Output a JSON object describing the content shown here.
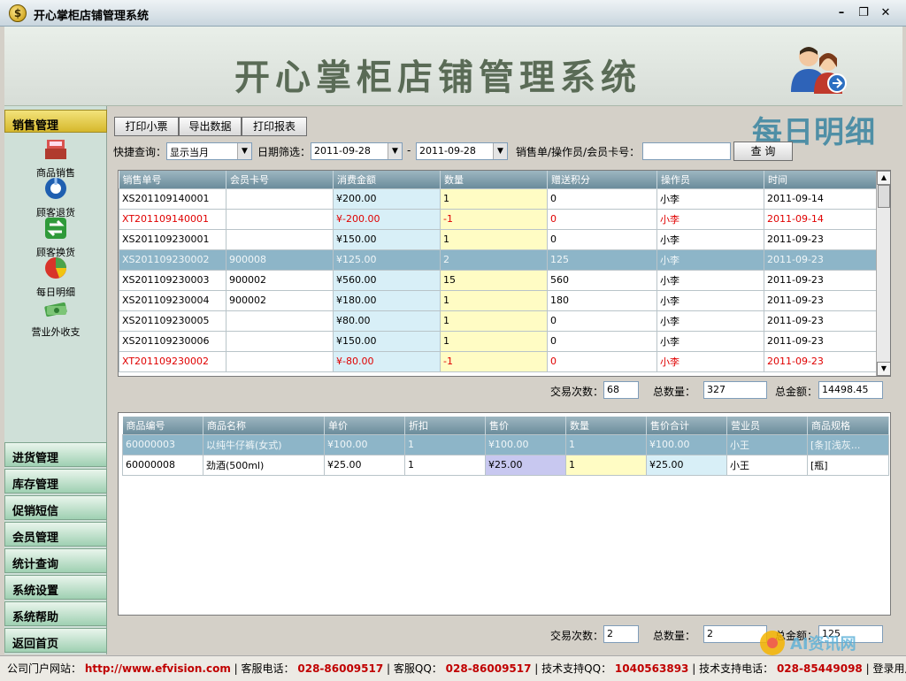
{
  "window": {
    "title": "开心掌柜店铺管理系统"
  },
  "banner": {
    "title": "开心掌柜店铺管理系统"
  },
  "sidebar": {
    "section": "销售管理",
    "icons": [
      {
        "label": "商品销售",
        "icon": "cash-register-icon",
        "color": "#c0392b"
      },
      {
        "label": "顾客退货",
        "icon": "return-icon",
        "color": "#1f5fb0"
      },
      {
        "label": "顾客换货",
        "icon": "exchange-icon",
        "color": "#2f9a3a"
      },
      {
        "label": "每日明细",
        "icon": "pie-chart-icon",
        "color": "#d8342a"
      },
      {
        "label": "营业外收支",
        "icon": "money-icon",
        "color": "#4aa34a"
      }
    ],
    "nav": [
      "进货管理",
      "库存管理",
      "促销短信",
      "会员管理",
      "统计查询",
      "系统设置",
      "系统帮助",
      "返回首页"
    ]
  },
  "toolbar": {
    "print_ticket": "打印小票",
    "export": "导出数据",
    "print_report": "打印报表"
  },
  "page_title": "每日明细",
  "filters": {
    "quick_label": "快捷查询：",
    "quick_value": "显示当月",
    "date_label": "日期筛选：",
    "date_from": "2011-09-28",
    "dash": "-",
    "date_to": "2011-09-28",
    "search_label": "销售单/操作员/会员卡号：",
    "search_value": "",
    "search_btn": "查 询"
  },
  "sales_table": {
    "columns": [
      "销售单号",
      "会员卡号",
      "消费金额",
      "数量",
      "赠送积分",
      "操作员",
      "时间"
    ],
    "rows": [
      {
        "id": "XS201109140001",
        "card": "",
        "amount": "¥200.00",
        "qty": "1",
        "points": "0",
        "op": "小李",
        "time": "2011-09-14",
        "style": ""
      },
      {
        "id": "XT201109140001",
        "card": "",
        "amount": "¥-200.00",
        "qty": "-1",
        "points": "0",
        "op": "小李",
        "time": "2011-09-14",
        "style": "red"
      },
      {
        "id": "XS201109230001",
        "card": "",
        "amount": "¥150.00",
        "qty": "1",
        "points": "0",
        "op": "小李",
        "time": "2011-09-23",
        "style": ""
      },
      {
        "id": "XS201109230002",
        "card": "900008",
        "amount": "¥125.00",
        "qty": "2",
        "points": "125",
        "op": "小李",
        "time": "2011-09-23",
        "style": "sel-row"
      },
      {
        "id": "XS201109230003",
        "card": "900002",
        "amount": "¥560.00",
        "qty": "15",
        "points": "560",
        "op": "小李",
        "time": "2011-09-23",
        "style": ""
      },
      {
        "id": "XS201109230004",
        "card": "900002",
        "amount": "¥180.00",
        "qty": "1",
        "points": "180",
        "op": "小李",
        "time": "2011-09-23",
        "style": ""
      },
      {
        "id": "XS201109230005",
        "card": "",
        "amount": "¥80.00",
        "qty": "1",
        "points": "0",
        "op": "小李",
        "time": "2011-09-23",
        "style": ""
      },
      {
        "id": "XS201109230006",
        "card": "",
        "amount": "¥150.00",
        "qty": "1",
        "points": "0",
        "op": "小李",
        "time": "2011-09-23",
        "style": ""
      },
      {
        "id": "XT201109230002",
        "card": "",
        "amount": "¥-80.00",
        "qty": "-1",
        "points": "0",
        "op": "小李",
        "time": "2011-09-23",
        "style": "red"
      }
    ]
  },
  "summary1": {
    "count_label": "交易次数：",
    "count": "68",
    "qty_label": "总数量：",
    "qty": "327",
    "total_label": "总金额：",
    "total": "14498.45"
  },
  "detail_table": {
    "columns": [
      "商品编号",
      "商品名称",
      "单价",
      "折扣",
      "售价",
      "数量",
      "售价合计",
      "营业员",
      "商品规格"
    ],
    "rows": [
      {
        "code": "60000003",
        "name": "以纯牛仔裤(女式)",
        "price": "¥100.00",
        "disc": "1",
        "sale": "¥100.00",
        "qty": "1",
        "sum": "¥100.00",
        "clerk": "小王",
        "spec": "[条][浅灰...",
        "style": "sel-row"
      },
      {
        "code": "60000008",
        "name": "劲酒(500ml)",
        "price": "¥25.00",
        "disc": "1",
        "sale": "¥25.00",
        "qty": "1",
        "sum": "¥25.00",
        "clerk": "小王",
        "spec": "[瓶]",
        "style": ""
      }
    ]
  },
  "summary2": {
    "count_label": "交易次数：",
    "count": "2",
    "qty_label": "总数量：",
    "qty": "2",
    "total_label": "总金额：",
    "total": "125"
  },
  "status": {
    "site_label": "公司门户网站：",
    "site": "http://www.efvision.com",
    "sep": "|",
    "cs_phone_label": "客服电话：",
    "cs_phone": "028-86009517",
    "cs_qq_label": "客服QQ：",
    "cs_qq": "028-86009517",
    "tech_qq_label": "技术支持QQ：",
    "tech_qq": "1040563893",
    "tech_phone_label": "技术支持电话：",
    "tech_phone": "028-85449098",
    "user": "登录用户"
  },
  "watermark": "AI资讯网"
}
